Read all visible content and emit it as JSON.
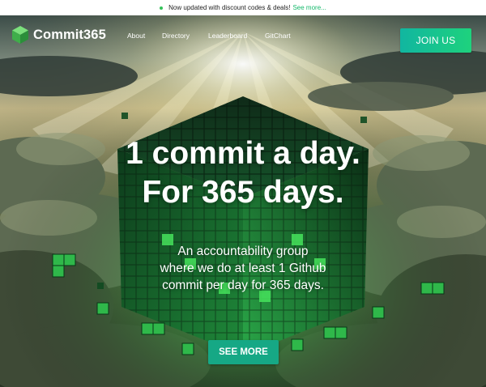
{
  "announcement": {
    "text": "Now updated with discount codes & deals!",
    "link": "See more..."
  },
  "brand": {
    "logo_icon": "green-cube-icon",
    "name": "Commit365"
  },
  "nav": {
    "links": [
      "About",
      "Directory",
      "Leaderboard",
      "GitChart"
    ],
    "cta": "JOIN US"
  },
  "hero": {
    "title_line1": "1 commit a day.",
    "title_line2": "For 365 days.",
    "subtitle_line1": "An accountability group",
    "subtitle_line2": "where we do at least 1 Github",
    "subtitle_line3": "commit per day for 365 days.",
    "button": "SEE MORE",
    "background": "green-cube-in-clouds-image"
  },
  "colors": {
    "accent": "#1ed27d",
    "teal": "#11b6a0",
    "button": "#16a885"
  }
}
